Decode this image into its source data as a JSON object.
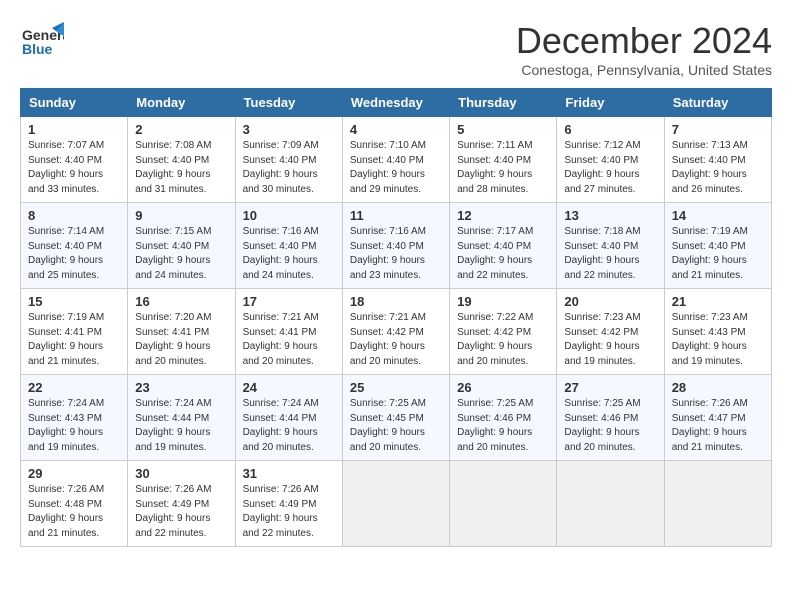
{
  "logo": {
    "line1": "General",
    "line2": "Blue"
  },
  "title": "December 2024",
  "subtitle": "Conestoga, Pennsylvania, United States",
  "days_of_week": [
    "Sunday",
    "Monday",
    "Tuesday",
    "Wednesday",
    "Thursday",
    "Friday",
    "Saturday"
  ],
  "weeks": [
    [
      {
        "day": 1,
        "info": "Sunrise: 7:07 AM\nSunset: 4:40 PM\nDaylight: 9 hours\nand 33 minutes."
      },
      {
        "day": 2,
        "info": "Sunrise: 7:08 AM\nSunset: 4:40 PM\nDaylight: 9 hours\nand 31 minutes."
      },
      {
        "day": 3,
        "info": "Sunrise: 7:09 AM\nSunset: 4:40 PM\nDaylight: 9 hours\nand 30 minutes."
      },
      {
        "day": 4,
        "info": "Sunrise: 7:10 AM\nSunset: 4:40 PM\nDaylight: 9 hours\nand 29 minutes."
      },
      {
        "day": 5,
        "info": "Sunrise: 7:11 AM\nSunset: 4:40 PM\nDaylight: 9 hours\nand 28 minutes."
      },
      {
        "day": 6,
        "info": "Sunrise: 7:12 AM\nSunset: 4:40 PM\nDaylight: 9 hours\nand 27 minutes."
      },
      {
        "day": 7,
        "info": "Sunrise: 7:13 AM\nSunset: 4:40 PM\nDaylight: 9 hours\nand 26 minutes."
      }
    ],
    [
      {
        "day": 8,
        "info": "Sunrise: 7:14 AM\nSunset: 4:40 PM\nDaylight: 9 hours\nand 25 minutes."
      },
      {
        "day": 9,
        "info": "Sunrise: 7:15 AM\nSunset: 4:40 PM\nDaylight: 9 hours\nand 24 minutes."
      },
      {
        "day": 10,
        "info": "Sunrise: 7:16 AM\nSunset: 4:40 PM\nDaylight: 9 hours\nand 24 minutes."
      },
      {
        "day": 11,
        "info": "Sunrise: 7:16 AM\nSunset: 4:40 PM\nDaylight: 9 hours\nand 23 minutes."
      },
      {
        "day": 12,
        "info": "Sunrise: 7:17 AM\nSunset: 4:40 PM\nDaylight: 9 hours\nand 22 minutes."
      },
      {
        "day": 13,
        "info": "Sunrise: 7:18 AM\nSunset: 4:40 PM\nDaylight: 9 hours\nand 22 minutes."
      },
      {
        "day": 14,
        "info": "Sunrise: 7:19 AM\nSunset: 4:40 PM\nDaylight: 9 hours\nand 21 minutes."
      }
    ],
    [
      {
        "day": 15,
        "info": "Sunrise: 7:19 AM\nSunset: 4:41 PM\nDaylight: 9 hours\nand 21 minutes."
      },
      {
        "day": 16,
        "info": "Sunrise: 7:20 AM\nSunset: 4:41 PM\nDaylight: 9 hours\nand 20 minutes."
      },
      {
        "day": 17,
        "info": "Sunrise: 7:21 AM\nSunset: 4:41 PM\nDaylight: 9 hours\nand 20 minutes."
      },
      {
        "day": 18,
        "info": "Sunrise: 7:21 AM\nSunset: 4:42 PM\nDaylight: 9 hours\nand 20 minutes."
      },
      {
        "day": 19,
        "info": "Sunrise: 7:22 AM\nSunset: 4:42 PM\nDaylight: 9 hours\nand 20 minutes."
      },
      {
        "day": 20,
        "info": "Sunrise: 7:23 AM\nSunset: 4:42 PM\nDaylight: 9 hours\nand 19 minutes."
      },
      {
        "day": 21,
        "info": "Sunrise: 7:23 AM\nSunset: 4:43 PM\nDaylight: 9 hours\nand 19 minutes."
      }
    ],
    [
      {
        "day": 22,
        "info": "Sunrise: 7:24 AM\nSunset: 4:43 PM\nDaylight: 9 hours\nand 19 minutes."
      },
      {
        "day": 23,
        "info": "Sunrise: 7:24 AM\nSunset: 4:44 PM\nDaylight: 9 hours\nand 19 minutes."
      },
      {
        "day": 24,
        "info": "Sunrise: 7:24 AM\nSunset: 4:44 PM\nDaylight: 9 hours\nand 20 minutes."
      },
      {
        "day": 25,
        "info": "Sunrise: 7:25 AM\nSunset: 4:45 PM\nDaylight: 9 hours\nand 20 minutes."
      },
      {
        "day": 26,
        "info": "Sunrise: 7:25 AM\nSunset: 4:46 PM\nDaylight: 9 hours\nand 20 minutes."
      },
      {
        "day": 27,
        "info": "Sunrise: 7:25 AM\nSunset: 4:46 PM\nDaylight: 9 hours\nand 20 minutes."
      },
      {
        "day": 28,
        "info": "Sunrise: 7:26 AM\nSunset: 4:47 PM\nDaylight: 9 hours\nand 21 minutes."
      }
    ],
    [
      {
        "day": 29,
        "info": "Sunrise: 7:26 AM\nSunset: 4:48 PM\nDaylight: 9 hours\nand 21 minutes."
      },
      {
        "day": 30,
        "info": "Sunrise: 7:26 AM\nSunset: 4:49 PM\nDaylight: 9 hours\nand 22 minutes."
      },
      {
        "day": 31,
        "info": "Sunrise: 7:26 AM\nSunset: 4:49 PM\nDaylight: 9 hours\nand 22 minutes."
      },
      null,
      null,
      null,
      null
    ]
  ]
}
